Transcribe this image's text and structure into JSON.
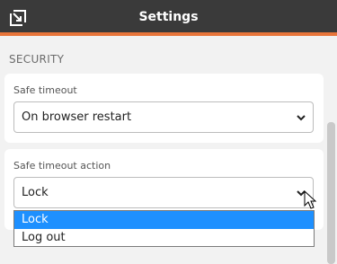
{
  "header": {
    "title": "Settings",
    "icon": "popout-icon"
  },
  "section": {
    "label": "SECURITY"
  },
  "safe_timeout": {
    "label": "Safe timeout",
    "value": "On browser restart"
  },
  "safe_timeout_action": {
    "label": "Safe timeout action",
    "value": "Lock",
    "options": [
      "Lock",
      "Log out"
    ],
    "highlighted_option": "Lock"
  },
  "colors": {
    "header_bg": "#3a3a3a",
    "accent": "#e8753a",
    "highlight": "#1e90ff"
  }
}
